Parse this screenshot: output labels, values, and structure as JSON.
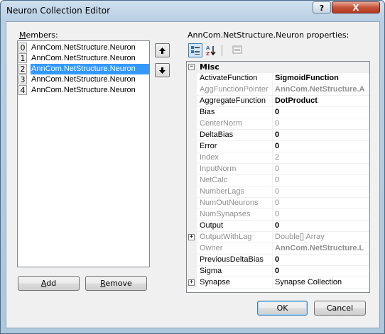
{
  "window": {
    "title": "Neuron Collection Editor",
    "help_glyph": "?",
    "close_glyph": "X"
  },
  "members": {
    "label_accel": "M",
    "label_rest": "embers:",
    "items": [
      {
        "index": "0",
        "text": "AnnCom.NetStructure.Neuron",
        "selected": false
      },
      {
        "index": "1",
        "text": "AnnCom.NetStructure.Neuron",
        "selected": false
      },
      {
        "index": "2",
        "text": "AnnCom.NetStructure.Neuron",
        "selected": true
      },
      {
        "index": "3",
        "text": "AnnCom.NetStructure.Neuron",
        "selected": false
      },
      {
        "index": "4",
        "text": "AnnCom.NetStructure.Neuron",
        "selected": false
      }
    ],
    "move_up_glyph": "▲",
    "move_down_glyph": "▼"
  },
  "properties": {
    "label": "AnnCom.NetStructure.Neuron properties:",
    "toolbar": {
      "categorized_icon": "categorized-icon",
      "alphabetical_icon": "alphabetical-icon",
      "property_pages_icon": "property-pages-icon"
    },
    "category": {
      "name": "Misc",
      "expander": "−"
    },
    "rows": [
      {
        "name": "ActivateFunction",
        "value": "SigmoidFunction",
        "readonly": false,
        "bold": true,
        "expander": ""
      },
      {
        "name": "AggFunctionPointer",
        "value": "AnnCom.NetStructure.A",
        "readonly": true,
        "bold": true,
        "expander": ""
      },
      {
        "name": "AggregateFunction",
        "value": "DotProduct",
        "readonly": false,
        "bold": true,
        "expander": ""
      },
      {
        "name": "Bias",
        "value": "0",
        "readonly": false,
        "bold": true,
        "expander": ""
      },
      {
        "name": "CenterNorm",
        "value": "0",
        "readonly": true,
        "bold": false,
        "expander": ""
      },
      {
        "name": "DeltaBias",
        "value": "0",
        "readonly": false,
        "bold": true,
        "expander": ""
      },
      {
        "name": "Error",
        "value": "0",
        "readonly": false,
        "bold": true,
        "expander": ""
      },
      {
        "name": "Index",
        "value": "2",
        "readonly": true,
        "bold": false,
        "expander": ""
      },
      {
        "name": "InputNorm",
        "value": "0",
        "readonly": true,
        "bold": false,
        "expander": ""
      },
      {
        "name": "NetCalc",
        "value": "0",
        "readonly": true,
        "bold": false,
        "expander": ""
      },
      {
        "name": "NumberLags",
        "value": "0",
        "readonly": true,
        "bold": false,
        "expander": ""
      },
      {
        "name": "NumOutNeurons",
        "value": "0",
        "readonly": true,
        "bold": false,
        "expander": ""
      },
      {
        "name": "NumSynapses",
        "value": "0",
        "readonly": true,
        "bold": false,
        "expander": ""
      },
      {
        "name": "Output",
        "value": "0",
        "readonly": false,
        "bold": true,
        "expander": ""
      },
      {
        "name": "OutputWithLag",
        "value": "Double[] Array",
        "readonly": true,
        "bold": false,
        "expander": "+"
      },
      {
        "name": "Owner",
        "value": "AnnCom.NetStructure.L",
        "readonly": true,
        "bold": true,
        "expander": ""
      },
      {
        "name": "PreviousDeltaBias",
        "value": "0",
        "readonly": false,
        "bold": true,
        "expander": ""
      },
      {
        "name": "Sigma",
        "value": "0",
        "readonly": false,
        "bold": true,
        "expander": ""
      },
      {
        "name": "Synapse",
        "value": "Synapse Collection",
        "readonly": false,
        "bold": false,
        "expander": "+"
      }
    ]
  },
  "buttons": {
    "add_accel": "A",
    "add_rest": "dd",
    "remove_accel": "R",
    "remove_rest": "emove",
    "ok": "OK",
    "cancel": "Cancel"
  }
}
